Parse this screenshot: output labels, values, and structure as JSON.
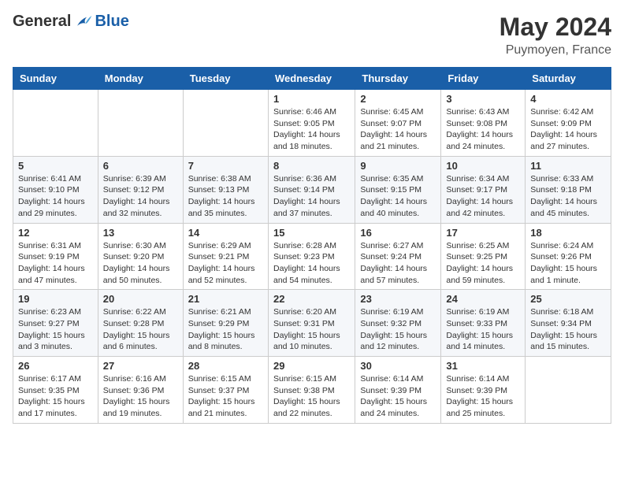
{
  "header": {
    "logo_general": "General",
    "logo_blue": "Blue",
    "month": "May 2024",
    "location": "Puymoyen, France"
  },
  "days_of_week": [
    "Sunday",
    "Monday",
    "Tuesday",
    "Wednesday",
    "Thursday",
    "Friday",
    "Saturday"
  ],
  "weeks": [
    [
      {
        "day": "",
        "info": ""
      },
      {
        "day": "",
        "info": ""
      },
      {
        "day": "",
        "info": ""
      },
      {
        "day": "1",
        "info": "Sunrise: 6:46 AM\nSunset: 9:05 PM\nDaylight: 14 hours and 18 minutes."
      },
      {
        "day": "2",
        "info": "Sunrise: 6:45 AM\nSunset: 9:07 PM\nDaylight: 14 hours and 21 minutes."
      },
      {
        "day": "3",
        "info": "Sunrise: 6:43 AM\nSunset: 9:08 PM\nDaylight: 14 hours and 24 minutes."
      },
      {
        "day": "4",
        "info": "Sunrise: 6:42 AM\nSunset: 9:09 PM\nDaylight: 14 hours and 27 minutes."
      }
    ],
    [
      {
        "day": "5",
        "info": "Sunrise: 6:41 AM\nSunset: 9:10 PM\nDaylight: 14 hours and 29 minutes."
      },
      {
        "day": "6",
        "info": "Sunrise: 6:39 AM\nSunset: 9:12 PM\nDaylight: 14 hours and 32 minutes."
      },
      {
        "day": "7",
        "info": "Sunrise: 6:38 AM\nSunset: 9:13 PM\nDaylight: 14 hours and 35 minutes."
      },
      {
        "day": "8",
        "info": "Sunrise: 6:36 AM\nSunset: 9:14 PM\nDaylight: 14 hours and 37 minutes."
      },
      {
        "day": "9",
        "info": "Sunrise: 6:35 AM\nSunset: 9:15 PM\nDaylight: 14 hours and 40 minutes."
      },
      {
        "day": "10",
        "info": "Sunrise: 6:34 AM\nSunset: 9:17 PM\nDaylight: 14 hours and 42 minutes."
      },
      {
        "day": "11",
        "info": "Sunrise: 6:33 AM\nSunset: 9:18 PM\nDaylight: 14 hours and 45 minutes."
      }
    ],
    [
      {
        "day": "12",
        "info": "Sunrise: 6:31 AM\nSunset: 9:19 PM\nDaylight: 14 hours and 47 minutes."
      },
      {
        "day": "13",
        "info": "Sunrise: 6:30 AM\nSunset: 9:20 PM\nDaylight: 14 hours and 50 minutes."
      },
      {
        "day": "14",
        "info": "Sunrise: 6:29 AM\nSunset: 9:21 PM\nDaylight: 14 hours and 52 minutes."
      },
      {
        "day": "15",
        "info": "Sunrise: 6:28 AM\nSunset: 9:23 PM\nDaylight: 14 hours and 54 minutes."
      },
      {
        "day": "16",
        "info": "Sunrise: 6:27 AM\nSunset: 9:24 PM\nDaylight: 14 hours and 57 minutes."
      },
      {
        "day": "17",
        "info": "Sunrise: 6:25 AM\nSunset: 9:25 PM\nDaylight: 14 hours and 59 minutes."
      },
      {
        "day": "18",
        "info": "Sunrise: 6:24 AM\nSunset: 9:26 PM\nDaylight: 15 hours and 1 minute."
      }
    ],
    [
      {
        "day": "19",
        "info": "Sunrise: 6:23 AM\nSunset: 9:27 PM\nDaylight: 15 hours and 3 minutes."
      },
      {
        "day": "20",
        "info": "Sunrise: 6:22 AM\nSunset: 9:28 PM\nDaylight: 15 hours and 6 minutes."
      },
      {
        "day": "21",
        "info": "Sunrise: 6:21 AM\nSunset: 9:29 PM\nDaylight: 15 hours and 8 minutes."
      },
      {
        "day": "22",
        "info": "Sunrise: 6:20 AM\nSunset: 9:31 PM\nDaylight: 15 hours and 10 minutes."
      },
      {
        "day": "23",
        "info": "Sunrise: 6:19 AM\nSunset: 9:32 PM\nDaylight: 15 hours and 12 minutes."
      },
      {
        "day": "24",
        "info": "Sunrise: 6:19 AM\nSunset: 9:33 PM\nDaylight: 15 hours and 14 minutes."
      },
      {
        "day": "25",
        "info": "Sunrise: 6:18 AM\nSunset: 9:34 PM\nDaylight: 15 hours and 15 minutes."
      }
    ],
    [
      {
        "day": "26",
        "info": "Sunrise: 6:17 AM\nSunset: 9:35 PM\nDaylight: 15 hours and 17 minutes."
      },
      {
        "day": "27",
        "info": "Sunrise: 6:16 AM\nSunset: 9:36 PM\nDaylight: 15 hours and 19 minutes."
      },
      {
        "day": "28",
        "info": "Sunrise: 6:15 AM\nSunset: 9:37 PM\nDaylight: 15 hours and 21 minutes."
      },
      {
        "day": "29",
        "info": "Sunrise: 6:15 AM\nSunset: 9:38 PM\nDaylight: 15 hours and 22 minutes."
      },
      {
        "day": "30",
        "info": "Sunrise: 6:14 AM\nSunset: 9:39 PM\nDaylight: 15 hours and 24 minutes."
      },
      {
        "day": "31",
        "info": "Sunrise: 6:14 AM\nSunset: 9:39 PM\nDaylight: 15 hours and 25 minutes."
      },
      {
        "day": "",
        "info": ""
      }
    ]
  ]
}
